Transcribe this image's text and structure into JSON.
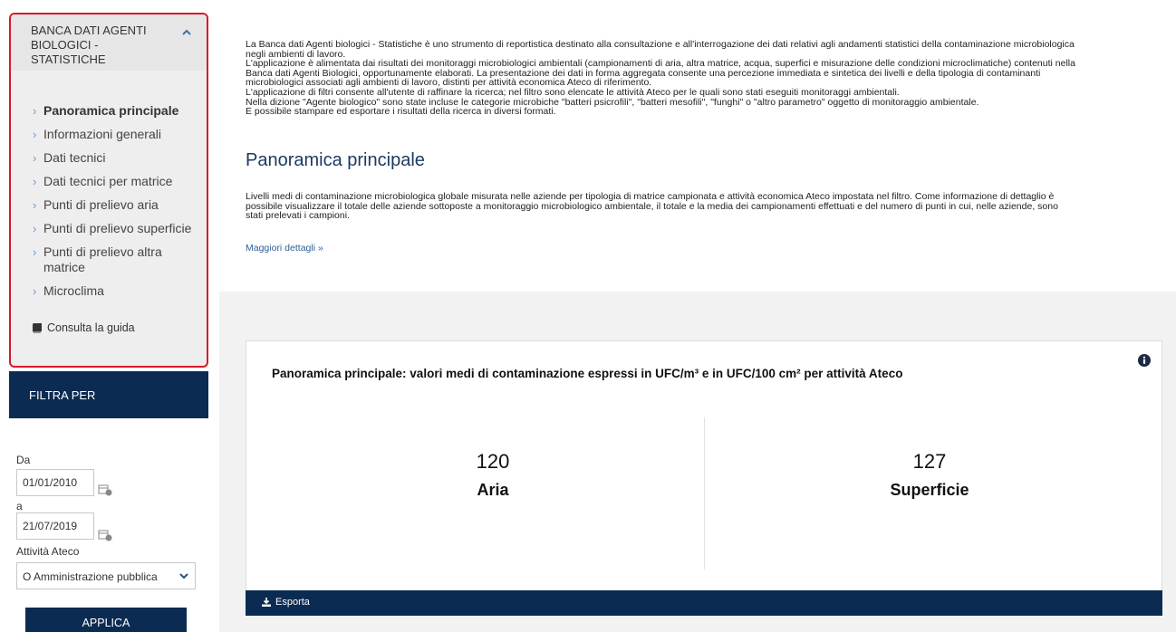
{
  "sidebar": {
    "title": "BANCA DATI AGENTI BIOLOGICI - STATISTICHE",
    "items": [
      {
        "label": "Panoramica principale",
        "active": true
      },
      {
        "label": "Informazioni generali",
        "active": false
      },
      {
        "label": "Dati tecnici",
        "active": false
      },
      {
        "label": "Dati tecnici per matrice",
        "active": false
      },
      {
        "label": "Punti di prelievo aria",
        "active": false
      },
      {
        "label": "Punti di prelievo superficie",
        "active": false
      },
      {
        "label": "Punti di prelievo altra matrice",
        "active": false
      },
      {
        "label": "Microclima",
        "active": false
      }
    ],
    "guide_label": "Consulta la guida"
  },
  "filter": {
    "header": "FILTRA PER",
    "from_label": "Da",
    "from_value": "01/01/2010",
    "to_label": "a",
    "to_value": "21/07/2019",
    "ateco_label": "Attività Ateco",
    "ateco_value": "O Amministrazione pubblica",
    "apply_label": "APPLICA"
  },
  "intro": [
    "La Banca dati Agenti biologici - Statistiche è uno strumento di reportistica destinato alla consultazione e all'interrogazione dei dati relativi agli andamenti statistici della contaminazione microbiologica",
    "negli ambienti di lavoro.",
    "L'applicazione è alimentata dai risultati dei monitoraggi microbiologici ambientali (campionamenti di aria, altra matrice, acqua, superfici e misurazione delle condizioni microclimatiche) contenuti nella",
    "Banca dati Agenti Biologici, opportunamente elaborati. La presentazione dei dati in forma aggregata consente una percezione immediata e sintetica dei livelli e della tipologia di contaminanti",
    "microbiologici associati agli ambienti di lavoro, distinti per attività economica Ateco di riferimento.",
    "L'applicazione di filtri consente all'utente di raffinare la ricerca; nel filtro sono elencate le attività Ateco per le quali sono stati eseguiti monitoraggi ambientali.",
    "Nella dizione \"Agente biologico\" sono state incluse le categorie microbiche \"batteri psicrofili\", \"batteri mesofili\", \"funghi\" o \"altro parametro\" oggetto di monitoraggio ambientale.",
    "È possibile stampare ed esportare i risultati della ricerca in diversi formati."
  ],
  "section": {
    "title": "Panoramica principale",
    "description": [
      "Livelli medi di contaminazione microbiologica globale misurata nelle aziende per tipologia di matrice campionata e attività economica Ateco impostata nel filtro. Come informazione di dettaglio è",
      "possibile visualizzare il totale delle aziende sottoposte a monitoraggio microbiologico ambientale, il totale e la media dei campionamenti effettuati e del numero di punti in cui, nelle aziende, sono",
      "stati prelevati i campioni."
    ],
    "more_link": "Maggiori dettagli »"
  },
  "card": {
    "title": "Panoramica principale: valori medi di contaminazione espressi in UFC/m³ e in UFC/100 cm² per attività Ateco",
    "stats": [
      {
        "value": "120",
        "label": "Aria"
      },
      {
        "value": "127",
        "label": "Superficie"
      }
    ],
    "export_label": "Esporta"
  },
  "colors": {
    "navy": "#0c2b52",
    "highlight_border": "#d7192a",
    "link": "#2e5f97"
  }
}
